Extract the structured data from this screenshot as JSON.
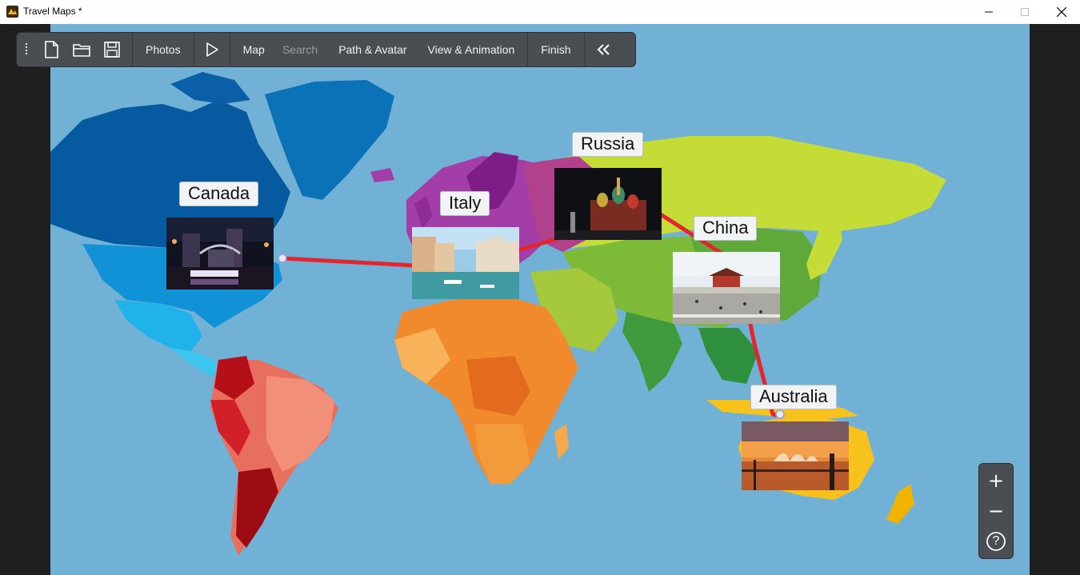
{
  "window": {
    "title": "Travel Maps *",
    "controls": [
      "minimize",
      "maximize",
      "close"
    ]
  },
  "toolbar": {
    "photos_label": "Photos",
    "map_label": "Map",
    "search_label": "Search",
    "path_avatar_label": "Path & Avatar",
    "view_animation_label": "View & Animation",
    "finish_label": "Finish"
  },
  "locations": [
    {
      "name": "Canada"
    },
    {
      "name": "Italy"
    },
    {
      "name": "Russia"
    },
    {
      "name": "China"
    },
    {
      "name": "Australia"
    }
  ],
  "zoom": {
    "in_symbol": "+",
    "out_symbol": "−",
    "help_symbol": "?"
  },
  "colors": {
    "ocean": "#72b1d6",
    "path": "#e3262d",
    "toolbar_bg": "#4a4d52",
    "north_america": "#0b72b8",
    "south_america": "#c91c25",
    "africa": "#f08a2c",
    "europe": "#a33ea8",
    "asia": "#9ccc2d",
    "oceania": "#f6c21b"
  }
}
